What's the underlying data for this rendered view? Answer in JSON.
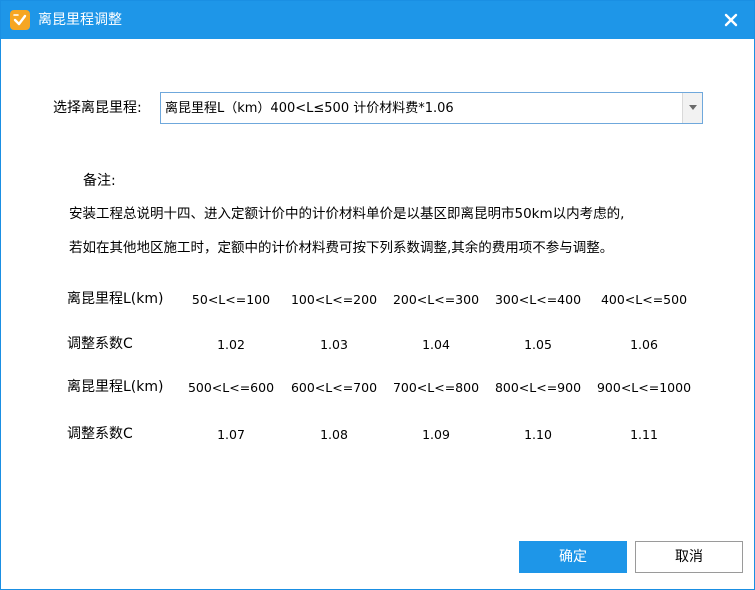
{
  "window": {
    "title": "离昆里程调整",
    "accent_color": "#1e96e8",
    "icon": "app-logo-icon",
    "close_icon": "close-icon"
  },
  "selector": {
    "label": "选择离昆里程:",
    "value": "离昆里程L（km）400<L≤500  计价材料费*1.06",
    "dropdown_icon": "chevron-down-icon"
  },
  "note": {
    "title": "备注:",
    "lines": [
      "安装工程总说明十四、进入定额计价中的计价材料单价是以基区即离昆明市50km以内考虑的,",
      "若如在其他地区施工时，定额中的计价材料费可按下列系数调整,其余的费用项不参与调整。"
    ]
  },
  "table": {
    "range_label": "离昆里程L(km)",
    "coef_label": "调整系数C",
    "ranges_1": [
      "50<L<=100",
      "100<L<=200",
      "200<L<=300",
      "300<L<=400",
      "400<L<=500"
    ],
    "coefs_1": [
      "1.02",
      "1.03",
      "1.04",
      "1.05",
      "1.06"
    ],
    "ranges_2": [
      "500<L<=600",
      "600<L<=700",
      "700<L<=800",
      "800<L<=900",
      "900<L<=1000"
    ],
    "coefs_2": [
      "1.07",
      "1.08",
      "1.09",
      "1.10",
      "1.11"
    ]
  },
  "buttons": {
    "ok": "确定",
    "cancel": "取消"
  }
}
